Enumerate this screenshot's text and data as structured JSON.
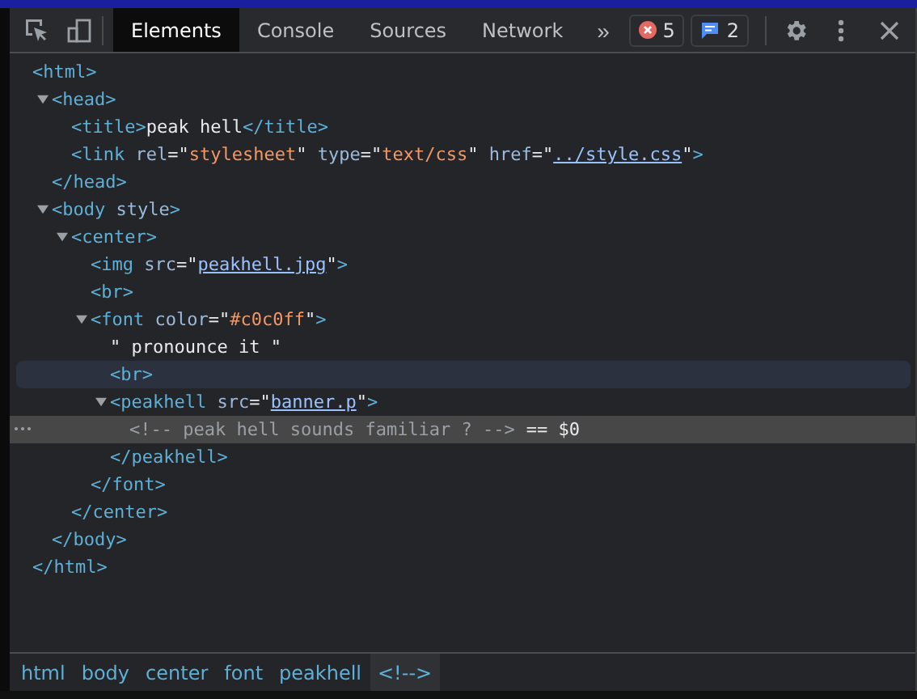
{
  "toolbar": {
    "tabs": [
      {
        "label": "Elements",
        "selected": true
      },
      {
        "label": "Console",
        "selected": false
      },
      {
        "label": "Sources",
        "selected": false
      },
      {
        "label": "Network",
        "selected": false
      }
    ],
    "more_tabs": "»",
    "error_count": "5",
    "message_count": "2"
  },
  "tree": [
    {
      "open": [
        {
          "kind": "tag",
          "text": "<html>"
        }
      ],
      "close": "</html>",
      "hovered": false,
      "selected": false,
      "children": [
        {
          "open": [
            {
              "kind": "tag",
              "text": "<head>"
            }
          ],
          "close": "</head>",
          "expanded": true,
          "hovered": false,
          "selected": false,
          "children": [
            {
              "open": [
                {
                  "kind": "tag",
                  "text": "<title>"
                },
                {
                  "kind": "text",
                  "text": "peak hell"
                },
                {
                  "kind": "tag",
                  "text": "</title>"
                }
              ],
              "hovered": false,
              "selected": false
            },
            {
              "open": [
                {
                  "kind": "tag",
                  "text": "<link"
                },
                {
                  "kind": "attr",
                  "text": " rel"
                },
                {
                  "kind": "punct",
                  "text": "=\""
                },
                {
                  "kind": "value",
                  "text": "stylesheet"
                },
                {
                  "kind": "punct",
                  "text": "\""
                },
                {
                  "kind": "attr",
                  "text": " type"
                },
                {
                  "kind": "punct",
                  "text": "=\""
                },
                {
                  "kind": "value",
                  "text": "text/css"
                },
                {
                  "kind": "punct",
                  "text": "\""
                },
                {
                  "kind": "attr",
                  "text": " href"
                },
                {
                  "kind": "punct",
                  "text": "=\""
                },
                {
                  "kind": "link",
                  "text": "../style.css"
                },
                {
                  "kind": "punct",
                  "text": "\""
                },
                {
                  "kind": "tag",
                  "text": ">"
                }
              ],
              "hovered": false,
              "selected": false
            }
          ]
        },
        {
          "open": [
            {
              "kind": "tag",
              "text": "<body"
            },
            {
              "kind": "attr",
              "text": " style"
            },
            {
              "kind": "tag",
              "text": ">"
            }
          ],
          "close": "</body>",
          "expanded": true,
          "hovered": false,
          "selected": false,
          "children": [
            {
              "open": [
                {
                  "kind": "tag",
                  "text": "<center>"
                }
              ],
              "close": "</center>",
              "expanded": true,
              "hovered": false,
              "selected": false,
              "children": [
                {
                  "open": [
                    {
                      "kind": "tag",
                      "text": "<img"
                    },
                    {
                      "kind": "attr",
                      "text": " src"
                    },
                    {
                      "kind": "punct",
                      "text": "=\""
                    },
                    {
                      "kind": "link",
                      "text": "peakhell.jpg"
                    },
                    {
                      "kind": "punct",
                      "text": "\""
                    },
                    {
                      "kind": "tag",
                      "text": ">"
                    }
                  ],
                  "hovered": false,
                  "selected": false
                },
                {
                  "open": [
                    {
                      "kind": "tag",
                      "text": "<br>"
                    }
                  ],
                  "hovered": false,
                  "selected": false
                },
                {
                  "open": [
                    {
                      "kind": "tag",
                      "text": "<font"
                    },
                    {
                      "kind": "attr",
                      "text": " color"
                    },
                    {
                      "kind": "punct",
                      "text": "=\""
                    },
                    {
                      "kind": "value",
                      "text": "#c0c0ff"
                    },
                    {
                      "kind": "punct",
                      "text": "\""
                    },
                    {
                      "kind": "tag",
                      "text": ">"
                    }
                  ],
                  "close": "</font>",
                  "expanded": true,
                  "hovered": false,
                  "selected": false,
                  "children": [
                    {
                      "open": [
                        {
                          "kind": "text",
                          "text": "\" pronounce it \""
                        }
                      ],
                      "hovered": false,
                      "selected": false
                    },
                    {
                      "open": [
                        {
                          "kind": "tag",
                          "text": "<br>"
                        }
                      ],
                      "hovered": true,
                      "selected": false
                    },
                    {
                      "open": [
                        {
                          "kind": "tag",
                          "text": "<peakhell"
                        },
                        {
                          "kind": "attr",
                          "text": " src"
                        },
                        {
                          "kind": "punct",
                          "text": "=\""
                        },
                        {
                          "kind": "link",
                          "text": "banner.p"
                        },
                        {
                          "kind": "punct",
                          "text": "\""
                        },
                        {
                          "kind": "tag",
                          "text": ">"
                        }
                      ],
                      "close": "</peakhell>",
                      "expanded": true,
                      "hovered": false,
                      "selected": false,
                      "children": [
                        {
                          "open": [
                            {
                              "kind": "comment",
                              "text": "<!-- peak hell sounds familiar ? -->"
                            }
                          ],
                          "marker": "== $0",
                          "hovered": false,
                          "selected": true
                        }
                      ]
                    }
                  ]
                }
              ]
            }
          ]
        }
      ]
    }
  ],
  "breadcrumbs": [
    {
      "label": "html",
      "selected": false
    },
    {
      "label": "body",
      "selected": false
    },
    {
      "label": "center",
      "selected": false
    },
    {
      "label": "font",
      "selected": false
    },
    {
      "label": "peakhell",
      "selected": false
    },
    {
      "label": "<!-->",
      "selected": true
    }
  ]
}
